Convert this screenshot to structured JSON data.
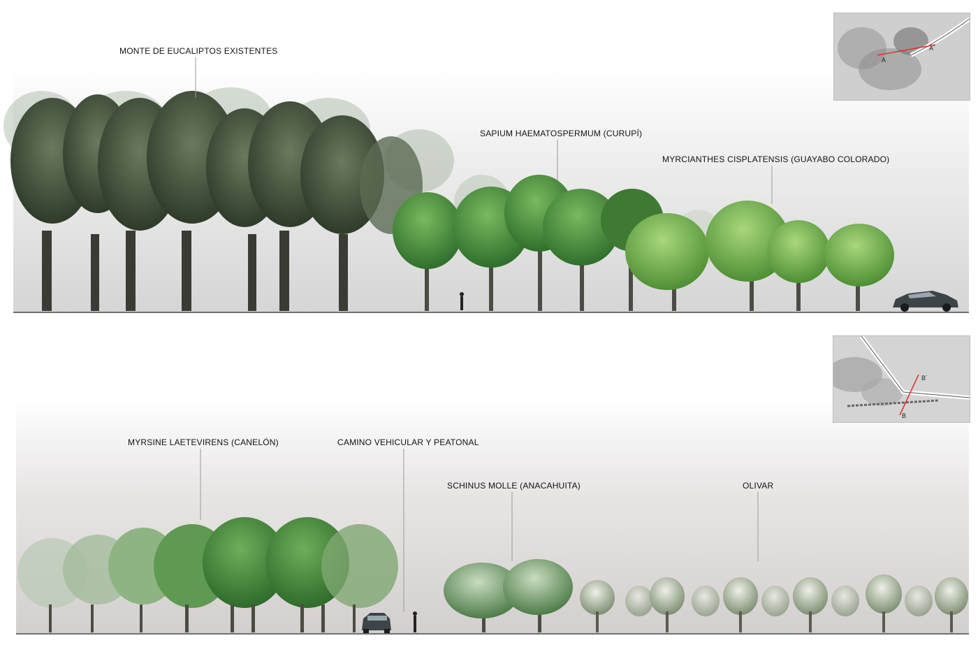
{
  "section_a": {
    "labels": {
      "eucalyptus": "MONTE DE EUCALIPTOS EXISTENTES",
      "curupi": "SAPIUM HAEMATOSPERMUM (CURUPÍ)",
      "guayabo": "MYRCIANTHES CISPLATENSIS (GUAYABO COLORADO)"
    },
    "keymap": {
      "marker_start": "A",
      "marker_end": "A´"
    }
  },
  "section_b": {
    "labels": {
      "canelon": "MYRSINE LAETEVIRENS (CANELÓN)",
      "camino": "CAMINO VEHICULAR Y PEATONAL",
      "anacahuita": "SCHINUS MOLLE  (ANACAHUITA)",
      "olivar": "OLIVAR"
    },
    "keymap": {
      "marker_start": "B",
      "marker_end": "B´"
    }
  },
  "colors": {
    "eucalyptus_canopy": "#3f4f37",
    "curupi_canopy": "#3d8a3a",
    "guayabo_canopy": "#6fae46",
    "canelon_canopy": "#3f7f36",
    "olive_canopy": "#b9c4ad",
    "section_line": "#e03030"
  }
}
